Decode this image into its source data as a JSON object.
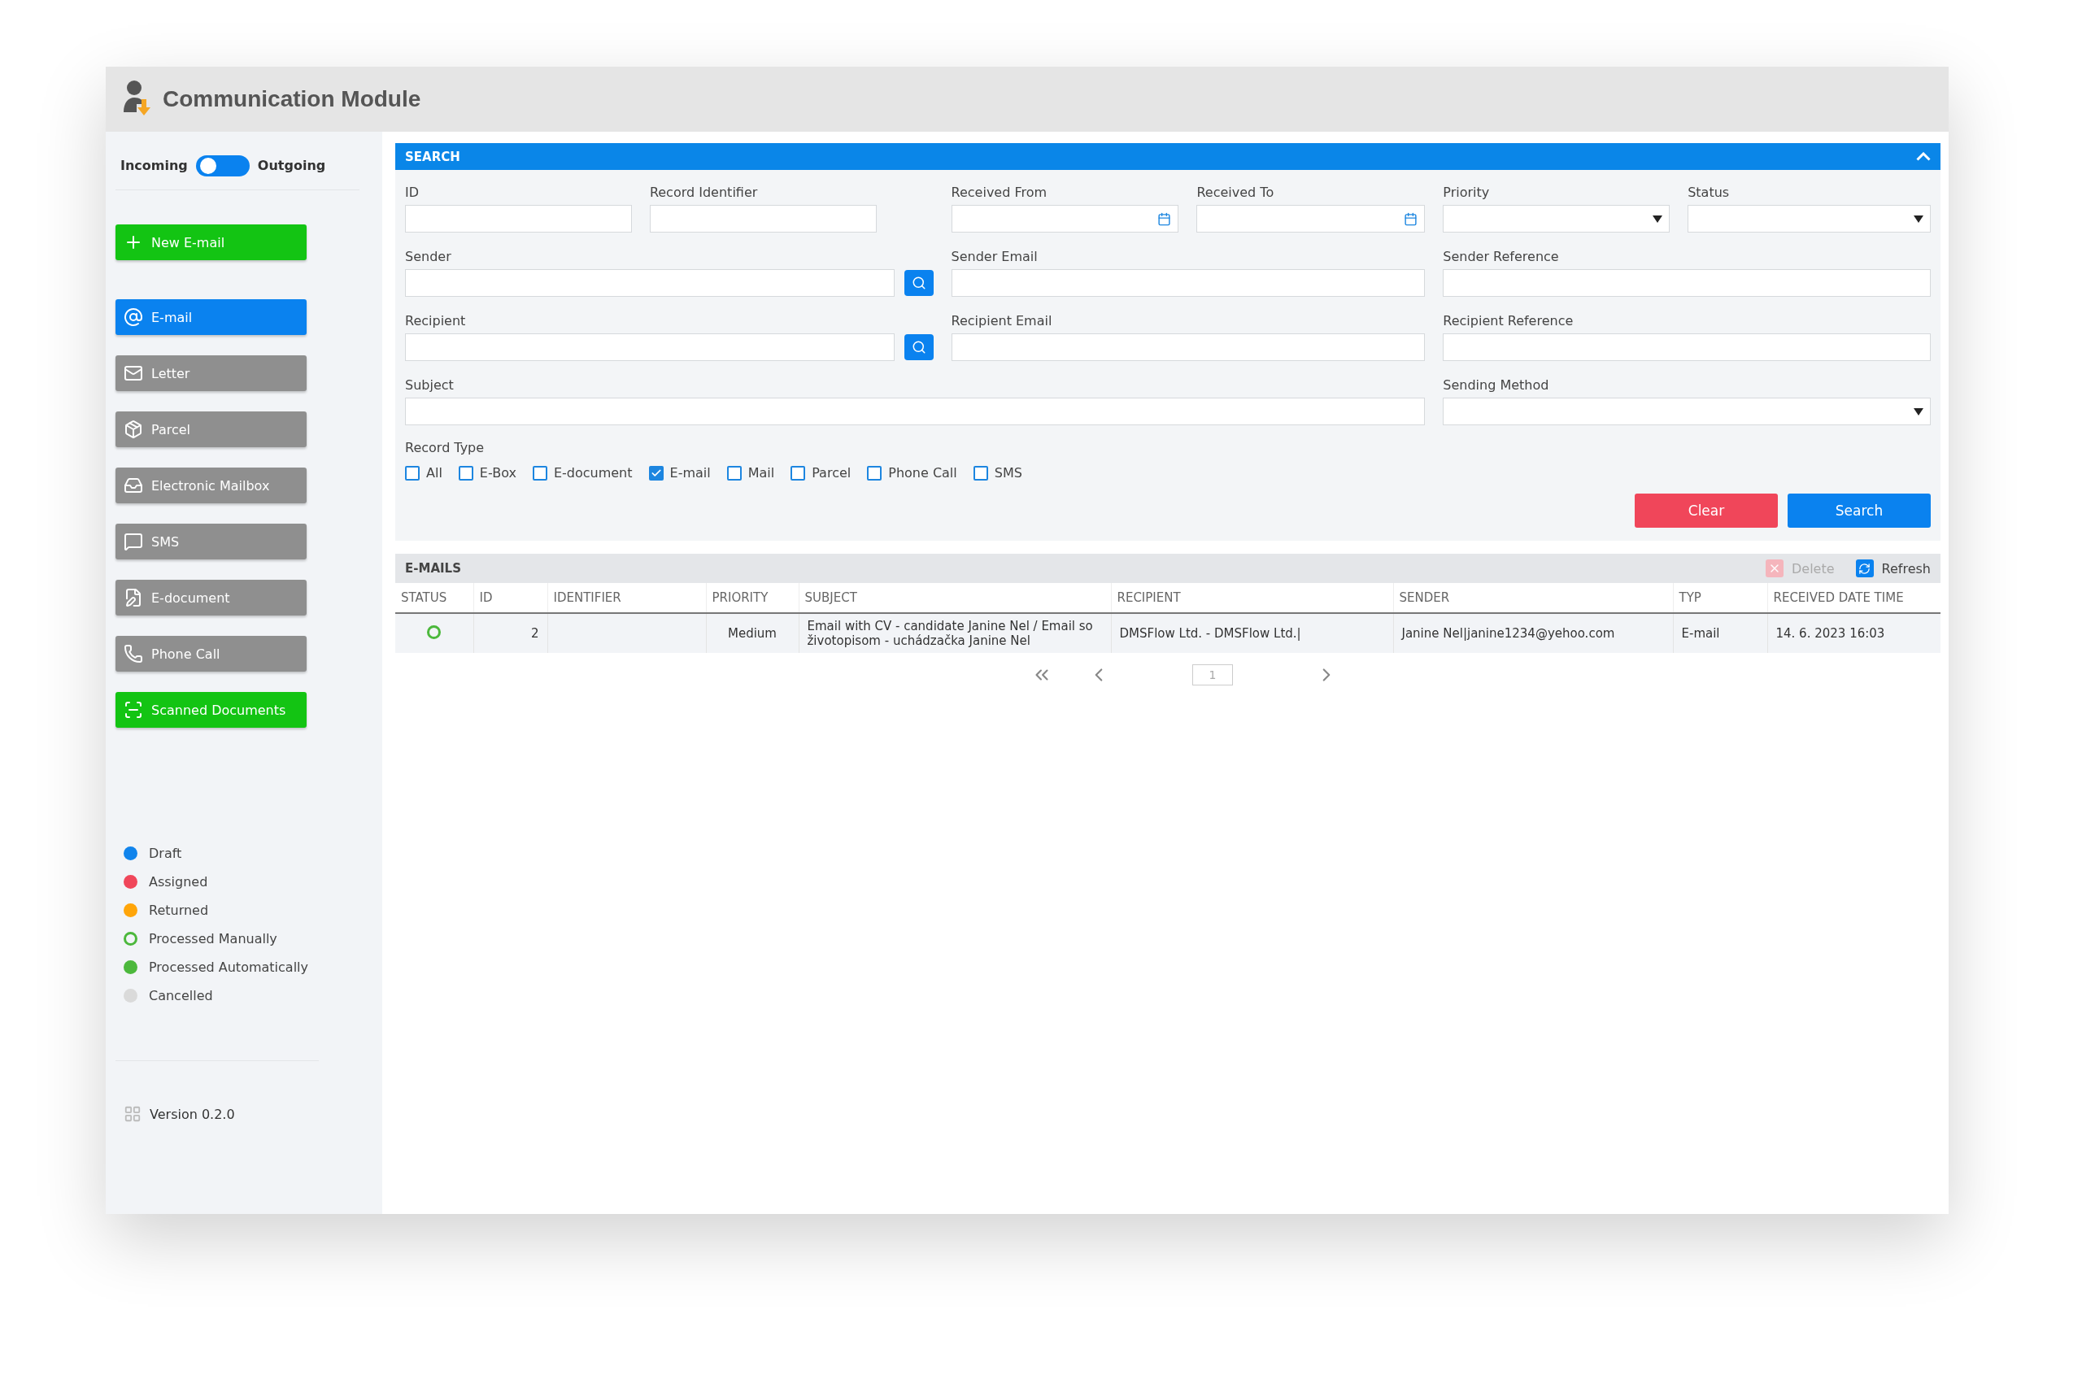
{
  "header": {
    "title": "Communication Module"
  },
  "sidebar": {
    "direction": {
      "left_label": "Incoming",
      "right_label": "Outgoing",
      "outgoing": false
    },
    "items": [
      {
        "label": "New E-mail",
        "kind": "action"
      },
      {
        "label": "E-mail",
        "kind": "nav",
        "selected": true
      },
      {
        "label": "Letter",
        "kind": "nav",
        "selected": false
      },
      {
        "label": "Parcel",
        "kind": "nav",
        "selected": false
      },
      {
        "label": "Electronic Mailbox",
        "kind": "nav",
        "selected": false
      },
      {
        "label": "SMS",
        "kind": "nav",
        "selected": false
      },
      {
        "label": "E-document",
        "kind": "nav",
        "selected": false
      },
      {
        "label": "Phone Call",
        "kind": "nav",
        "selected": false
      },
      {
        "label": "Scanned Documents",
        "kind": "action"
      }
    ],
    "legend": [
      {
        "label": "Draft",
        "kind": "dot",
        "color": "#1184ec"
      },
      {
        "label": "Assigned",
        "kind": "dot",
        "color": "#f0465a"
      },
      {
        "label": "Returned",
        "kind": "dot",
        "color": "#ffa50a"
      },
      {
        "label": "Processed Manually",
        "kind": "ring",
        "color": "#4cb83c"
      },
      {
        "label": "Processed Automatically",
        "kind": "dot",
        "color": "#4cb83c"
      },
      {
        "label": "Cancelled",
        "kind": "dot",
        "color": "#dadada"
      }
    ],
    "version": "Version 0.2.0"
  },
  "search": {
    "title": "SEARCH",
    "expanded": true,
    "fields": [
      {
        "label": "ID",
        "kind": "text"
      },
      {
        "label": "Record Identifier",
        "kind": "text"
      },
      {
        "label": "Received From",
        "kind": "date"
      },
      {
        "label": "Received To",
        "kind": "date"
      },
      {
        "label": "Priority",
        "kind": "select"
      },
      {
        "label": "Status",
        "kind": "select"
      },
      {
        "label": "Sender",
        "kind": "lookup"
      },
      {
        "label": "Sender Email",
        "kind": "text"
      },
      {
        "label": "Sender Reference",
        "kind": "text"
      },
      {
        "label": "Recipient",
        "kind": "lookup"
      },
      {
        "label": "Recipient Email",
        "kind": "text"
      },
      {
        "label": "Recipient Reference",
        "kind": "text"
      },
      {
        "label": "Subject",
        "kind": "text"
      },
      {
        "label": "Sending Method",
        "kind": "select"
      }
    ],
    "record_type": {
      "label": "Record Type",
      "options": [
        {
          "label": "All",
          "checked": false
        },
        {
          "label": "E-Box",
          "checked": false
        },
        {
          "label": "E-document",
          "checked": false
        },
        {
          "label": "E-mail",
          "checked": true
        },
        {
          "label": "Mail",
          "checked": false
        },
        {
          "label": "Parcel",
          "checked": false
        },
        {
          "label": "Phone Call",
          "checked": false
        },
        {
          "label": "SMS",
          "checked": false
        }
      ]
    },
    "buttons": [
      {
        "label": "Clear",
        "kind": "danger"
      },
      {
        "label": "Search",
        "kind": "primary"
      }
    ]
  },
  "emails": {
    "title": "E-MAILS",
    "actions": [
      {
        "label": "Delete",
        "kind": "delete",
        "disabled": true
      },
      {
        "label": "Refresh",
        "kind": "refresh",
        "disabled": false
      }
    ],
    "columns": [
      "STATUS",
      "ID",
      "IDENTIFIER",
      "PRIORITY",
      "SUBJECT",
      "RECIPIENT",
      "SENDER",
      "TYP",
      "RECEIVED DATE TIME"
    ],
    "rows": [
      {
        "status": {
          "kind": "ring",
          "color": "#4cb83c"
        },
        "id": "2",
        "priority": "Medium",
        "subject": "Email with CV - candidate Janine Nel / Email so životopisom - uchádzačka Janine Nel",
        "recipient": "DMSFlow Ltd. - DMSFlow Ltd.|",
        "sender": "Janine Nel|janine1234@yehoo.com",
        "typ": "E-mail",
        "received": "14. 6. 2023 16:03"
      }
    ],
    "pagination": {
      "page": "1"
    }
  }
}
